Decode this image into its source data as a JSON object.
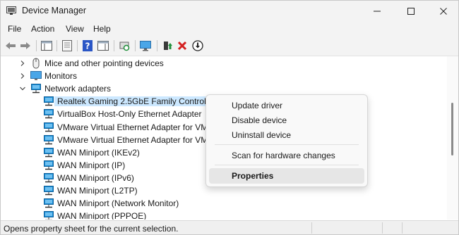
{
  "window": {
    "title": "Device Manager",
    "controls": {
      "minimize": "minimize-icon",
      "maximize": "maximize-icon",
      "close": "close-icon"
    }
  },
  "menu": [
    "File",
    "Action",
    "View",
    "Help"
  ],
  "toolbar_icons": [
    "back-arrow-icon",
    "forward-arrow-icon",
    "properties-pane-icon",
    "device-view-icon",
    "help-icon",
    "action-pane-icon",
    "scan-hardware-icon",
    "monitor-icon",
    "update-driver-icon",
    "uninstall-device-icon",
    "disable-device-icon"
  ],
  "tree": [
    {
      "label": "Mice and other pointing devices",
      "icon": "mouse-icon",
      "level": 1,
      "expander": "collapsed"
    },
    {
      "label": "Monitors",
      "icon": "monitor-icon",
      "level": 1,
      "expander": "collapsed"
    },
    {
      "label": "Network adapters",
      "icon": "network-adapter-icon",
      "level": 1,
      "expander": "expanded"
    },
    {
      "label": "Realtek Gaming 2.5GbE Family Controller",
      "icon": "network-adapter-icon",
      "level": 2,
      "selected": true
    },
    {
      "label": "VirtualBox Host-Only Ethernet Adapter",
      "icon": "network-adapter-icon",
      "level": 2
    },
    {
      "label": "VMware Virtual Ethernet Adapter for VMn",
      "icon": "network-adapter-icon",
      "level": 2
    },
    {
      "label": "VMware Virtual Ethernet Adapter for VMn",
      "icon": "network-adapter-icon",
      "level": 2
    },
    {
      "label": "WAN Miniport (IKEv2)",
      "icon": "network-adapter-icon",
      "level": 2
    },
    {
      "label": "WAN Miniport (IP)",
      "icon": "network-adapter-icon",
      "level": 2
    },
    {
      "label": "WAN Miniport (IPv6)",
      "icon": "network-adapter-icon",
      "level": 2
    },
    {
      "label": "WAN Miniport (L2TP)",
      "icon": "network-adapter-icon",
      "level": 2
    },
    {
      "label": "WAN Miniport (Network Monitor)",
      "icon": "network-adapter-icon",
      "level": 2
    },
    {
      "label": "WAN Miniport (PPPOE)",
      "icon": "network-adapter-icon",
      "level": 2
    }
  ],
  "context_menu": {
    "items": [
      {
        "label": "Update driver"
      },
      {
        "label": "Disable device"
      },
      {
        "label": "Uninstall device"
      },
      {
        "separator": true
      },
      {
        "label": "Scan for hardware changes"
      },
      {
        "separator": true
      },
      {
        "label": "Properties",
        "bold": true,
        "hover": true
      }
    ]
  },
  "status": {
    "text": "Opens property sheet for the current selection."
  },
  "colors": {
    "selection": "#cce8ff",
    "adapter": "#1a8fd8",
    "uninstall": "#d42020",
    "update": "#1f8f3a"
  }
}
